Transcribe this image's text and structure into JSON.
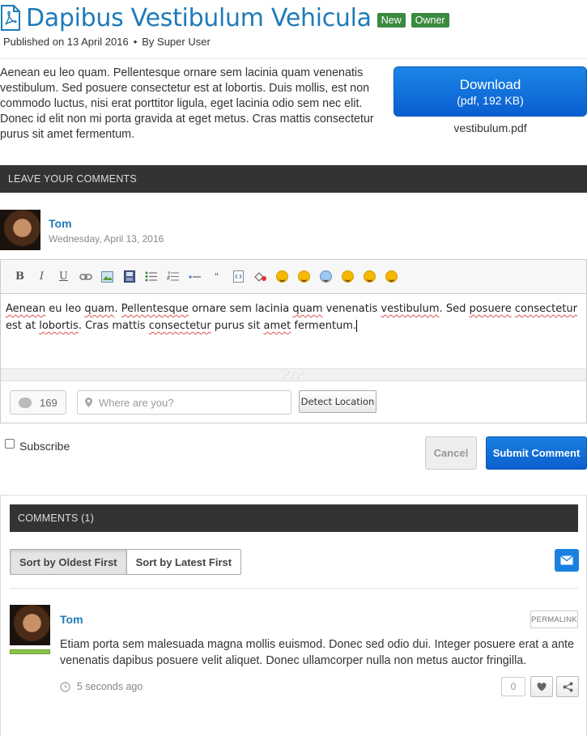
{
  "article": {
    "title": "Dapibus Vestibulum Vehicula",
    "badge_new": "New",
    "badge_owner": "Owner",
    "published": "Published on 13 April 2016",
    "separator": "•",
    "author": "By Super User",
    "intro": "Aenean eu leo quam. Pellentesque ornare sem lacinia quam venenatis vestibulum. Sed posuere consectetur est at lobortis. Duis mollis, est non commodo luctus, nisi erat porttitor ligula, eget lacinia odio sem nec elit. Donec id elit non mi porta gravida at eget metus. Cras mattis consectetur purus sit amet fermentum.",
    "download": {
      "label": "Download",
      "info": "(pdf, 192 KB)",
      "filename": "vestibulum.pdf"
    }
  },
  "comment_form": {
    "header": "Leave your comments",
    "user_name": "Tom",
    "date": "Wednesday, April 13, 2016",
    "toolbar": {
      "bold": "B",
      "italic": "I",
      "underline": "U",
      "quote": "“"
    },
    "text_words": [
      "Aenean",
      " eu leo ",
      "quam",
      ". ",
      "Pellentesque",
      " ornare sem lacinia ",
      "quam",
      " venenatis ",
      "vestibulum",
      ". Sed ",
      "posuere",
      " ",
      "consectetur",
      " est at ",
      "lobortis",
      ". Cras mattis ",
      "consectetur",
      " purus sit ",
      "amet",
      " fermentum."
    ],
    "char_count": "169",
    "location_placeholder": "Where are you?",
    "detect_location": "Detect Location",
    "subscribe": "Subscribe",
    "cancel": "Cancel",
    "submit": "Submit Comment"
  },
  "comments": {
    "header": "Comments (1)",
    "sort_oldest": "Sort by Oldest First",
    "sort_latest": "Sort by Latest First",
    "items": [
      {
        "author": "Tom",
        "permalink": "PERMALINK",
        "body": "Etiam porta sem malesuada magna mollis euismod. Donec sed odio dui. Integer posuere erat a ante venenatis dapibus posuere velit aliquet. Donec ullamcorper nulla non metus auctor fringilla.",
        "time": "5 seconds ago",
        "likes": "0"
      }
    ]
  },
  "colors": {
    "link_blue": "#1e7bb8",
    "button_blue": "#0b5fcf",
    "badge_green": "#3c8a3f",
    "header_bar": "#333333"
  }
}
